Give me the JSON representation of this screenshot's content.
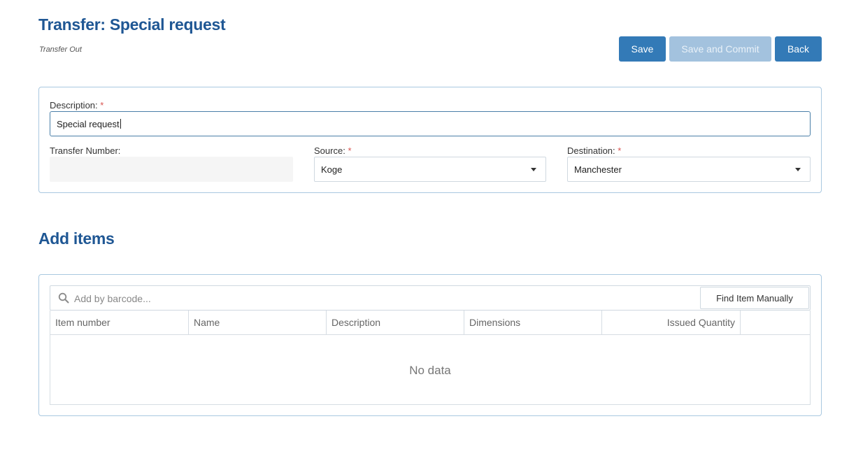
{
  "header": {
    "title": "Transfer: Special request",
    "subtitle": "Transfer Out"
  },
  "actions": {
    "save_label": "Save",
    "save_commit_label": "Save and Commit",
    "back_label": "Back"
  },
  "form": {
    "description_label": "Description:",
    "description_value": "Special request",
    "transfer_number_label": "Transfer Number:",
    "transfer_number_value": "",
    "source_label": "Source:",
    "source_value": "Koge",
    "destination_label": "Destination:",
    "destination_value": "Manchester",
    "required_marker": "*"
  },
  "items": {
    "section_title": "Add items",
    "search_placeholder": "Add by barcode...",
    "find_manually_label": "Find Item Manually",
    "columns": [
      "Item number",
      "Name",
      "Description",
      "Dimensions",
      "Issued Quantity",
      ""
    ],
    "empty_text": "No data"
  },
  "colors": {
    "primary": "#337ab7",
    "primary_disabled": "#a3c2de",
    "title": "#1f5794",
    "required": "#d9534f"
  }
}
